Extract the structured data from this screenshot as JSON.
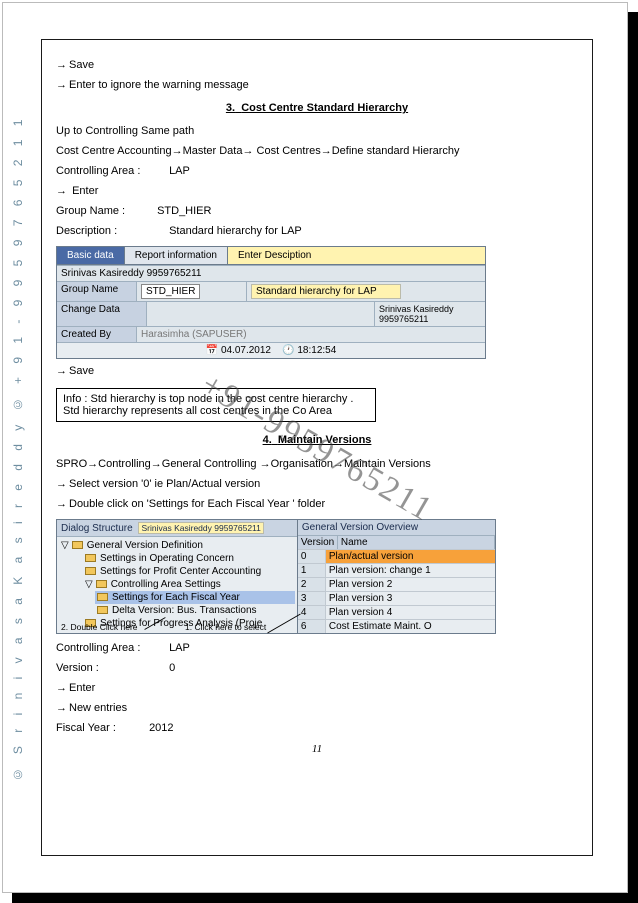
{
  "sidebar_text": "© S r i n i v a s a   K a s i r e d d y ©   + 9 1 - 9 9 5 9 7 6 5 2 1 1",
  "watermark": "+91-9959765211",
  "page_number": "11",
  "lines": {
    "save": "Save",
    "ignore_warn": "Enter to ignore the warning message",
    "section3_num": "3.",
    "section3_title": "Cost Centre Standard Hierarchy",
    "uptopath": "Up to Controlling Same path",
    "navpath3": "Cost Centre Accounting→Master Data→ Cost Centres→Define standard Hierarchy",
    "ctrl_area_lbl": "Controlling Area  :",
    "ctrl_area_val": "LAP",
    "enter": "Enter",
    "group_lbl": " Group Name      :",
    "group_val": "STD_HIER",
    "desc_lbl": "Description         :",
    "desc_val": "Standard hierarchy for LAP",
    "save2": "Save",
    "info1": "Info : Std hierarchy is top node in the cost centre hierarchy  .",
    "info2": "Std hierarchy represents all cost centres in the Co Area",
    "section4_num": "4.",
    "section4_title": "Maintain Versions",
    "navpath4": "SPRO→Controlling→General Controlling →Organisation→Maintain Versions",
    "sel_ver": "Select version '0'   ie Plan/Actual version",
    "dbl_click": "Double click  on 'Settings for Each Fiscal Year '  folder",
    "ctrl_area2_lbl": "Controlling Area  :",
    "ctrl_area2_val": "LAP",
    "ver_lbl": "Version       :",
    "ver_val": "0",
    "enter2": "Enter",
    "new_entries": "New entries",
    "fy_lbl": "Fiscal Year :",
    "fy_val": "2012"
  },
  "sap1": {
    "tab1": "Basic data",
    "tab2": "Report information",
    "tab3": "Enter Desciption",
    "row_author": "Srinivas Kasireddy 9959765211",
    "row_group_lbl": "Group Name",
    "row_group_val": "STD_HIER",
    "row_desc_val": "Standard hierarchy for LAP",
    "change_data": "Change Data",
    "created_by": "Created By",
    "created_by_val": "Harasimha (SAPUSER)",
    "right_val": "Srinivas Kasireddy 9959765211",
    "date": "04.07.2012",
    "time": "18:12:54"
  },
  "dlg": {
    "left_hdr": "Dialog Structure",
    "author": "Srinivas Kasireddy 9959765211",
    "right_hdr": "General Version Overview",
    "tree": [
      "General Version Definition",
      "Settings in Operating Concern",
      "Settings for Profit Center Accounting",
      "Controlling Area Settings",
      "Settings for Each Fiscal Year",
      "Delta Version: Bus. Transactions",
      "Settings for Progress Analysis (Proje"
    ],
    "th1": "Version",
    "th2": "Name",
    "rows": [
      {
        "v": "0",
        "n": "Plan/actual version"
      },
      {
        "v": "1",
        "n": "Plan version: change 1"
      },
      {
        "v": "2",
        "n": "Plan version 2"
      },
      {
        "v": "3",
        "n": "Plan version 3"
      },
      {
        "v": "4",
        "n": "Plan version 4"
      },
      {
        "v": "6",
        "n": "Cost Estimate Maint. O"
      }
    ],
    "annot_left": "2. Double Click here",
    "annot_right": "1. Click here to select"
  }
}
